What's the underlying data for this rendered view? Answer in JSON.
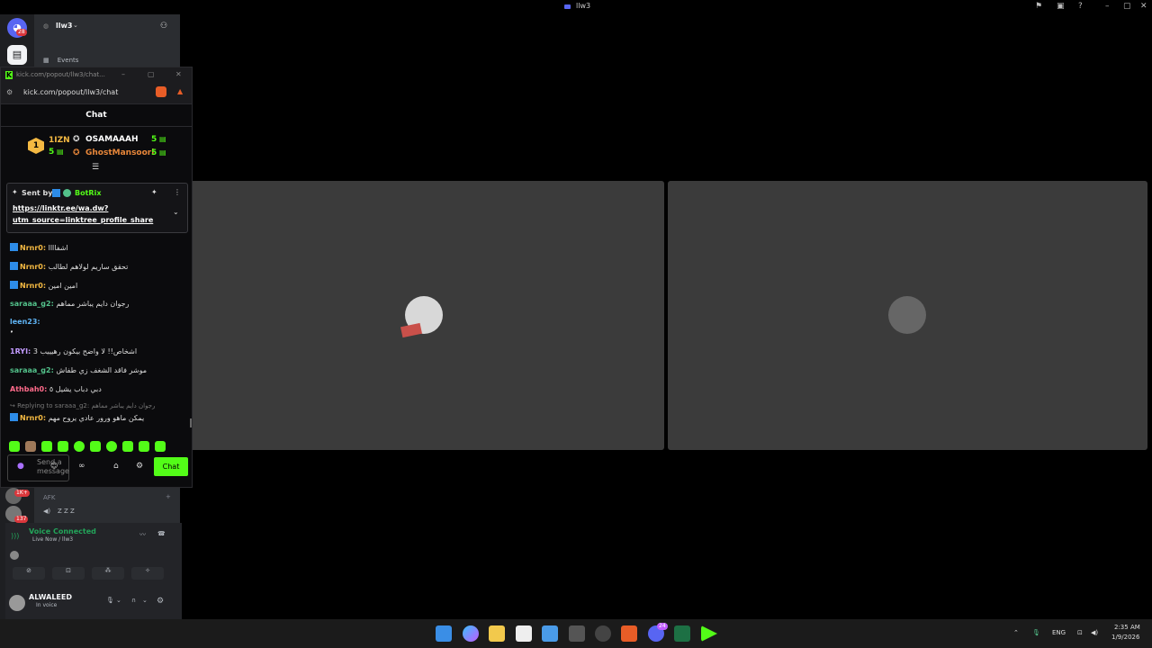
{
  "window": {
    "title": "llw3",
    "title_icon": "screen-share-icon",
    "controls": [
      "pin-icon",
      "inbox-icon",
      "help-icon",
      "minimize-icon",
      "maximize-icon",
      "close-icon"
    ]
  },
  "discord": {
    "home_badge": "28",
    "server_name": "llw3",
    "channels": [
      {
        "label": "Events",
        "icon": "calendar-icon"
      }
    ],
    "rail_badges": [
      "1K+",
      "137"
    ],
    "voice_channel": {
      "name": "AFK",
      "members_text": "Z Z Z"
    },
    "voice_connected": {
      "label": "Voice Connected",
      "sub": "Live Now / llw3"
    },
    "voice_buttons": [
      "camera-off-icon",
      "screen-share-icon",
      "activities-icon",
      "soundboard-icon"
    ],
    "user": {
      "name": "ALWALEED",
      "status": "In voice"
    },
    "colors": {
      "green": "#23a55a",
      "blurple": "#5865f2"
    }
  },
  "popout": {
    "title": "kick.com/popout/llw3/chat...",
    "url": "kick.com/popout/llw3/chat",
    "header": "Chat",
    "leaderboard": {
      "rank": "1",
      "top_user": "1IZN",
      "top_value": "5",
      "entries": [
        {
          "name": "OSAMAAAH",
          "value": "5"
        },
        {
          "name": "GhostMansoori",
          "value": "5"
        }
      ]
    },
    "pinned": {
      "sent_by_label": "Sent by",
      "sender": "BotRix",
      "link_line1": "https://linktr.ee/wa.dw?",
      "link_line2": "utm_source=linktree_profile_share"
    },
    "messages": [
      {
        "user": "Nrnr0:",
        "text": "اشفاااا",
        "color": "#f4b942",
        "verified": true
      },
      {
        "user": "Nrnr0:",
        "text": "تحقق ساريم لولاهم لطالب",
        "color": "#f4b942",
        "verified": true
      },
      {
        "user": "Nrnr0:",
        "text": "امين امين",
        "color": "#f4b942",
        "verified": true
      },
      {
        "user": "saraaa_g2:",
        "text": "رجوان دايم يباشر مماهم",
        "color": "#53c28b",
        "verified": false
      },
      {
        "user": "leen23:",
        "text": "",
        "color": "#5fb4f5",
        "verified": false
      },
      {
        "user": "",
        "text": "ٔٔٔٔٔٔٔٔٔٔٔٔٔٔٔٔٔٔٔٔٔٔٔٔٔٔٔٔٔٔٔٔٔٔٔٔٔٔٔٔٔٔٔٔٔٔٔٔٔٔٔٔ",
        "color": "#ddd",
        "verified": false
      },
      {
        "user": "1RYI:",
        "text": "3 اشخاص!! لا واضح بيكون رهيييب",
        "color": "#c39bff",
        "verified": false
      },
      {
        "user": "saraaa_g2:",
        "text": "موشر فاقد الشغف زي طفاش",
        "color": "#53c28b",
        "verified": false
      },
      {
        "user": "Athbah0:",
        "text": "دبي دباب يشيل ٥",
        "color": "#ff6b8b",
        "verified": false
      }
    ],
    "reply": {
      "label": "Replying to saraaa_g2:",
      "quoted": "رجوان دايم يباشر مماهم",
      "user": "Nrnr0:",
      "text": "يمكن ماهو ورور عادي يروح مهم"
    },
    "input_placeholder": "Send a message",
    "send_label": "Chat",
    "colors": {
      "kick_green": "#53fc18"
    }
  },
  "taskbar": {
    "lang": "ENG",
    "time": "2:35 AM",
    "date": "1/9/2026",
    "discord_badge": "24"
  }
}
